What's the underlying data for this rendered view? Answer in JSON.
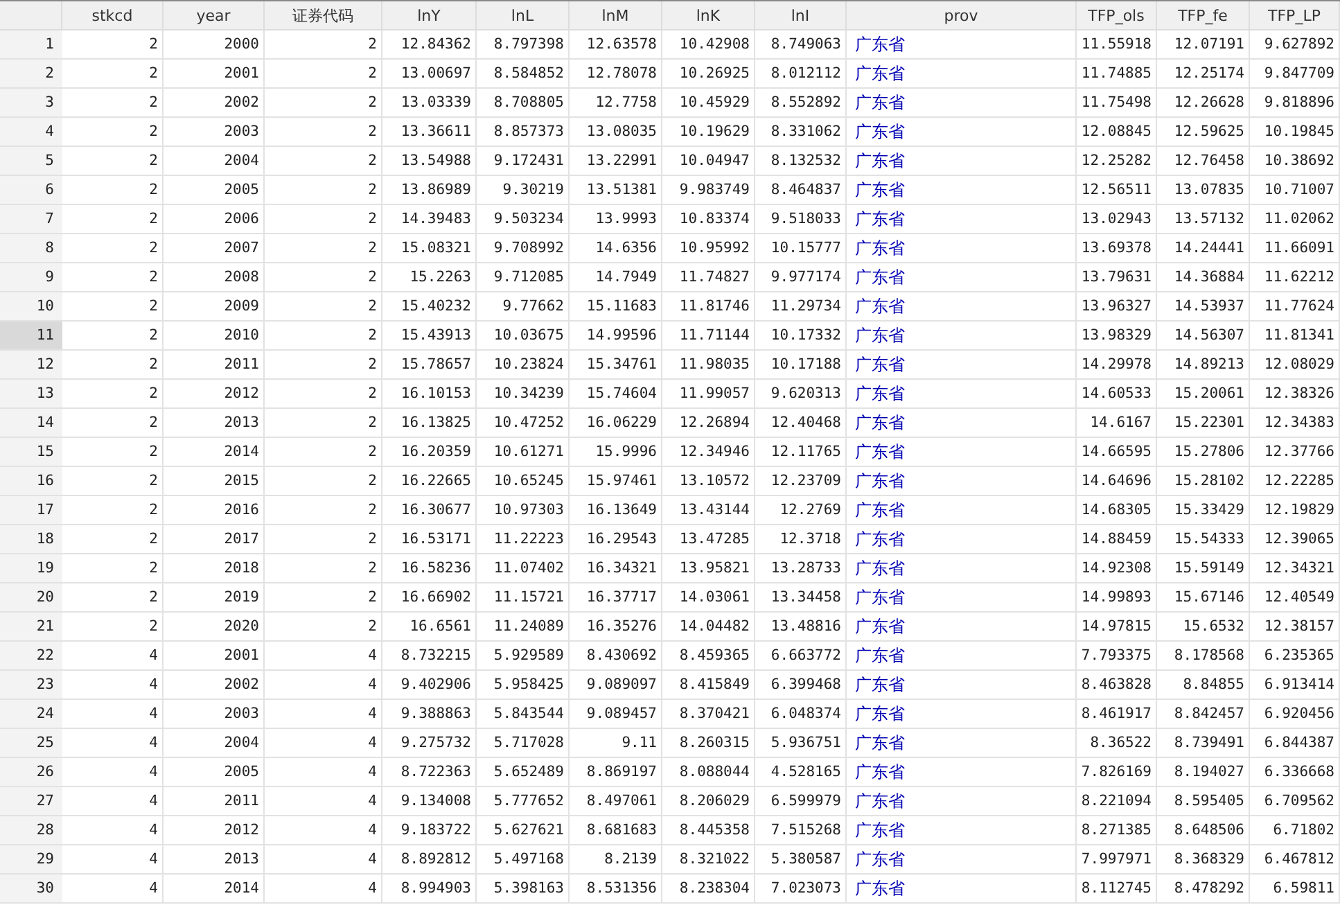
{
  "columns": [
    {
      "label": "stkcd",
      "kind": "numeric"
    },
    {
      "label": "year",
      "kind": "numeric"
    },
    {
      "label": "证券代码",
      "kind": "numeric"
    },
    {
      "label": "lnY",
      "kind": "numeric"
    },
    {
      "label": "lnL",
      "kind": "numeric"
    },
    {
      "label": "lnM",
      "kind": "numeric"
    },
    {
      "label": "lnK",
      "kind": "numeric"
    },
    {
      "label": "lnI",
      "kind": "numeric"
    },
    {
      "label": "prov",
      "kind": "labeled"
    },
    {
      "label": "TFP_ols",
      "kind": "numeric"
    },
    {
      "label": "TFP_fe",
      "kind": "numeric"
    },
    {
      "label": "TFP_LP",
      "kind": "numeric"
    }
  ],
  "rows": [
    {
      "number": "1",
      "selected": false,
      "cells": [
        "2",
        "2000",
        "2",
        "12.84362",
        "8.797398",
        "12.63578",
        "10.42908",
        "8.749063",
        "广东省",
        "11.55918",
        "12.07191",
        "9.627892"
      ]
    },
    {
      "number": "2",
      "selected": false,
      "cells": [
        "2",
        "2001",
        "2",
        "13.00697",
        "8.584852",
        "12.78078",
        "10.26925",
        "8.012112",
        "广东省",
        "11.74885",
        "12.25174",
        "9.847709"
      ]
    },
    {
      "number": "3",
      "selected": false,
      "cells": [
        "2",
        "2002",
        "2",
        "13.03339",
        "8.708805",
        "12.7758",
        "10.45929",
        "8.552892",
        "广东省",
        "11.75498",
        "12.26628",
        "9.818896"
      ]
    },
    {
      "number": "4",
      "selected": false,
      "cells": [
        "2",
        "2003",
        "2",
        "13.36611",
        "8.857373",
        "13.08035",
        "10.19629",
        "8.331062",
        "广东省",
        "12.08845",
        "12.59625",
        "10.19845"
      ]
    },
    {
      "number": "5",
      "selected": false,
      "cells": [
        "2",
        "2004",
        "2",
        "13.54988",
        "9.172431",
        "13.22991",
        "10.04947",
        "8.132532",
        "广东省",
        "12.25282",
        "12.76458",
        "10.38692"
      ]
    },
    {
      "number": "6",
      "selected": false,
      "cells": [
        "2",
        "2005",
        "2",
        "13.86989",
        "9.30219",
        "13.51381",
        "9.983749",
        "8.464837",
        "广东省",
        "12.56511",
        "13.07835",
        "10.71007"
      ]
    },
    {
      "number": "7",
      "selected": false,
      "cells": [
        "2",
        "2006",
        "2",
        "14.39483",
        "9.503234",
        "13.9993",
        "10.83374",
        "9.518033",
        "广东省",
        "13.02943",
        "13.57132",
        "11.02062"
      ]
    },
    {
      "number": "8",
      "selected": false,
      "cells": [
        "2",
        "2007",
        "2",
        "15.08321",
        "9.708992",
        "14.6356",
        "10.95992",
        "10.15777",
        "广东省",
        "13.69378",
        "14.24441",
        "11.66091"
      ]
    },
    {
      "number": "9",
      "selected": false,
      "cells": [
        "2",
        "2008",
        "2",
        "15.2263",
        "9.712085",
        "14.7949",
        "11.74827",
        "9.977174",
        "广东省",
        "13.79631",
        "14.36884",
        "11.62212"
      ]
    },
    {
      "number": "10",
      "selected": false,
      "cells": [
        "2",
        "2009",
        "2",
        "15.40232",
        "9.77662",
        "15.11683",
        "11.81746",
        "11.29734",
        "广东省",
        "13.96327",
        "14.53937",
        "11.77624"
      ]
    },
    {
      "number": "11",
      "selected": true,
      "cells": [
        "2",
        "2010",
        "2",
        "15.43913",
        "10.03675",
        "14.99596",
        "11.71144",
        "10.17332",
        "广东省",
        "13.98329",
        "14.56307",
        "11.81341"
      ]
    },
    {
      "number": "12",
      "selected": false,
      "cells": [
        "2",
        "2011",
        "2",
        "15.78657",
        "10.23824",
        "15.34761",
        "11.98035",
        "10.17188",
        "广东省",
        "14.29978",
        "14.89213",
        "12.08029"
      ]
    },
    {
      "number": "13",
      "selected": false,
      "cells": [
        "2",
        "2012",
        "2",
        "16.10153",
        "10.34239",
        "15.74604",
        "11.99057",
        "9.620313",
        "广东省",
        "14.60533",
        "15.20061",
        "12.38326"
      ]
    },
    {
      "number": "14",
      "selected": false,
      "cells": [
        "2",
        "2013",
        "2",
        "16.13825",
        "10.47252",
        "16.06229",
        "12.26894",
        "12.40468",
        "广东省",
        "14.6167",
        "15.22301",
        "12.34383"
      ]
    },
    {
      "number": "15",
      "selected": false,
      "cells": [
        "2",
        "2014",
        "2",
        "16.20359",
        "10.61271",
        "15.9996",
        "12.34946",
        "12.11765",
        "广东省",
        "14.66595",
        "15.27806",
        "12.37766"
      ]
    },
    {
      "number": "16",
      "selected": false,
      "cells": [
        "2",
        "2015",
        "2",
        "16.22665",
        "10.65245",
        "15.97461",
        "13.10572",
        "12.23709",
        "广东省",
        "14.64696",
        "15.28102",
        "12.22285"
      ]
    },
    {
      "number": "17",
      "selected": false,
      "cells": [
        "2",
        "2016",
        "2",
        "16.30677",
        "10.97303",
        "16.13649",
        "13.43144",
        "12.2769",
        "广东省",
        "14.68305",
        "15.33429",
        "12.19829"
      ]
    },
    {
      "number": "18",
      "selected": false,
      "cells": [
        "2",
        "2017",
        "2",
        "16.53171",
        "11.22223",
        "16.29543",
        "13.47285",
        "12.3718",
        "广东省",
        "14.88459",
        "15.54333",
        "12.39065"
      ]
    },
    {
      "number": "19",
      "selected": false,
      "cells": [
        "2",
        "2018",
        "2",
        "16.58236",
        "11.07402",
        "16.34321",
        "13.95821",
        "13.28733",
        "广东省",
        "14.92308",
        "15.59149",
        "12.34321"
      ]
    },
    {
      "number": "20",
      "selected": false,
      "cells": [
        "2",
        "2019",
        "2",
        "16.66902",
        "11.15721",
        "16.37717",
        "14.03061",
        "13.34458",
        "广东省",
        "14.99893",
        "15.67146",
        "12.40549"
      ]
    },
    {
      "number": "21",
      "selected": false,
      "cells": [
        "2",
        "2020",
        "2",
        "16.6561",
        "11.24089",
        "16.35276",
        "14.04482",
        "13.48816",
        "广东省",
        "14.97815",
        "15.6532",
        "12.38157"
      ]
    },
    {
      "number": "22",
      "selected": false,
      "cells": [
        "4",
        "2001",
        "4",
        "8.732215",
        "5.929589",
        "8.430692",
        "8.459365",
        "6.663772",
        "广东省",
        "7.793375",
        "8.178568",
        "6.235365"
      ]
    },
    {
      "number": "23",
      "selected": false,
      "cells": [
        "4",
        "2002",
        "4",
        "9.402906",
        "5.958425",
        "9.089097",
        "8.415849",
        "6.399468",
        "广东省",
        "8.463828",
        "8.84855",
        "6.913414"
      ]
    },
    {
      "number": "24",
      "selected": false,
      "cells": [
        "4",
        "2003",
        "4",
        "9.388863",
        "5.843544",
        "9.089457",
        "8.370421",
        "6.048374",
        "广东省",
        "8.461917",
        "8.842457",
        "6.920456"
      ]
    },
    {
      "number": "25",
      "selected": false,
      "cells": [
        "4",
        "2004",
        "4",
        "9.275732",
        "5.717028",
        "9.11",
        "8.260315",
        "5.936751",
        "广东省",
        "8.36522",
        "8.739491",
        "6.844387"
      ]
    },
    {
      "number": "26",
      "selected": false,
      "cells": [
        "4",
        "2005",
        "4",
        "8.722363",
        "5.652489",
        "8.869197",
        "8.088044",
        "4.528165",
        "广东省",
        "7.826169",
        "8.194027",
        "6.336668"
      ]
    },
    {
      "number": "27",
      "selected": false,
      "cells": [
        "4",
        "2011",
        "4",
        "9.134008",
        "5.777652",
        "8.497061",
        "8.206029",
        "6.599979",
        "广东省",
        "8.221094",
        "8.595405",
        "6.709562"
      ]
    },
    {
      "number": "28",
      "selected": false,
      "cells": [
        "4",
        "2012",
        "4",
        "9.183722",
        "5.627621",
        "8.681683",
        "8.445358",
        "7.515268",
        "广东省",
        "8.271385",
        "8.648506",
        "6.71802"
      ]
    },
    {
      "number": "29",
      "selected": false,
      "cells": [
        "4",
        "2013",
        "4",
        "8.892812",
        "5.497168",
        "8.2139",
        "8.321022",
        "5.380587",
        "广东省",
        "7.997971",
        "8.368329",
        "6.467812"
      ]
    },
    {
      "number": "30",
      "selected": false,
      "cells": [
        "4",
        "2014",
        "4",
        "8.994903",
        "5.398163",
        "8.531356",
        "8.238304",
        "7.023073",
        "广东省",
        "8.112745",
        "8.478292",
        "6.59811"
      ]
    }
  ]
}
